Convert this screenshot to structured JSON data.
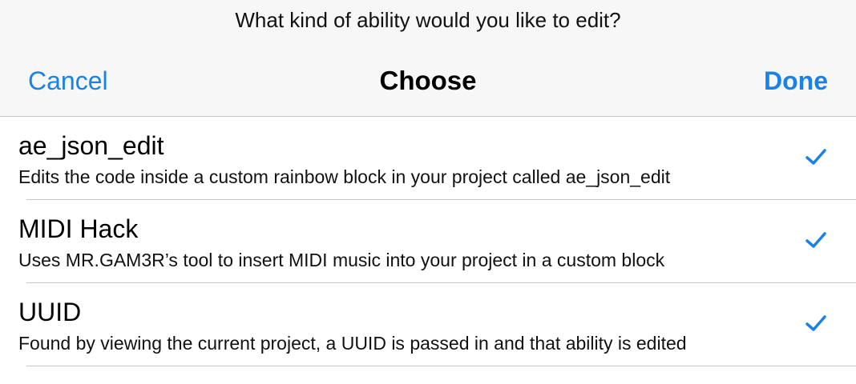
{
  "header": {
    "prompt": "What kind of ability would you like to edit?",
    "cancel_label": "Cancel",
    "title": "Choose",
    "done_label": "Done"
  },
  "list": {
    "items": [
      {
        "title": "ae_json_edit",
        "subtitle": "Edits the code inside a custom rainbow block in your project called ae_json_edit",
        "checked": true
      },
      {
        "title": "MIDI Hack",
        "subtitle": "Uses MR.GAM3R’s tool to insert MIDI music into your project in a custom block",
        "checked": true
      },
      {
        "title": "UUID",
        "subtitle": "Found by viewing the current project, a UUID is passed in and that ability is edited",
        "checked": true
      }
    ]
  },
  "colors": {
    "accent": "#1a82e6",
    "header_bg": "#f7f7f7",
    "separator": "#c8c7cc"
  }
}
